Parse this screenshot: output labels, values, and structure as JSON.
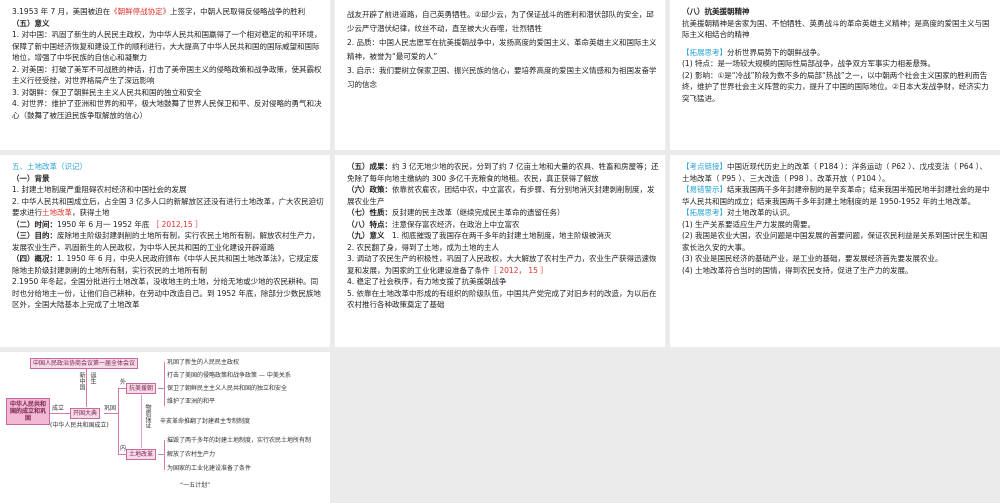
{
  "slides": {
    "r1s1": {
      "line_treaty_prefix": "3.1953 年 7 月，美国被迫在",
      "treaty": "《朝鲜停战协定》",
      "line_treaty_suffix": "上签字，中朝人民取得反侵略战争的胜利",
      "heading": "（五）意义",
      "items": [
        "1. 对中国：巩固了新生的人民民主政权，为中华人民共和国赢得了一个相对稳定的和平环境，保障了新中国经济恢复和建设工作的顺利进行，大大提高了中华人民共和国的国际威望和国际地位，增强了中华民族的自信心和凝聚力",
        "2. 对美国：打破了美军不可战胜的神话，打击了美帝国主义的侵略政策和战争政策，使其霸权主义行径受挫，对世界格局产生了深远影响",
        "3. 对朝鲜：保卫了朝鲜民主主义人民共和国的独立和安全",
        "4. 对世界：维护了亚洲和世界的和平，极大地鼓舞了世界人民保卫和平、反对侵略的勇气和决心（鼓舞了被压迫民族争取解放的信心）"
      ]
    },
    "r1s2": {
      "items": [
        "战友开辟了前进道路，自己英勇牺牲。②邱少云，为了保证战斗的胜利和潜伏部队的安全，邱少云严守潜伏纪律，纹丝不动，直至被大火吞噬，壮烈牺牲",
        "2. 品质：中国人民志愿军在抗美援朝战争中，发扬高度的爱国主义、革命英雄主义和国际主义精神，被誉为“最可爱的人”",
        "3. 启示：我们要树立保家卫国、振兴民族的信心，要培养高度的爱国主义情感和为祖国发奋学习的信念"
      ]
    },
    "r1s3": {
      "heading": "（八）抗美援朝精神",
      "spirit": "抗美援朝精神是舍家为国、不怕牺牲、英勇战斗的革命英雄主义精神；是高度的爱国主义与国际主义相结合的精神",
      "tag": "【拓展思考】",
      "question": "分析世界局势下的朝鲜战争。",
      "items": [
        "(1) 特点：是一场较大规模的国际性局部战争，战争双方军事实力相差悬殊。",
        "(2) 影响：①是“冷战”阶段为数不多的局部“热战”之一，以中朝两个社会主义国家的胜利而告终，维护了世界社会主义阵营的实力，提升了中国的国际地位。②日本大发战争财，经济实力突飞猛进。"
      ]
    },
    "r2s1": {
      "title": "五、土地改革（识记）",
      "h1": "（一）背景",
      "bg1": "1. 封建土地制度严重阻碍农村经济和中国社会的发展",
      "bg2_prefix": "2. 中华人民共和国成立后，占全国 3 亿多人口的新解放区还没有进行土地改革，广大农民迫切要求进行",
      "bg2_red": "土地改革",
      "bg2_suffix": "，获得土地",
      "time_label": "（二）时间：",
      "time": "1950 年 6 月一 1952 年底",
      "time_ref": "［ 2012,15 ］",
      "goal_label": "（三）目的：",
      "goal": "废除地主阶级封建剥削的土地所有制，实行农民土地所有制，解放农村生产力，发展农业生产，巩固新生的人民政权，为中华人民共和国的工业化建设开辟道路",
      "overview_label": "（四）概况：",
      "overview1": "1. 1950 年 6 月，中央人民政府颁布《中华人民共和国土地改革法》，它规定废除地主阶级封建剥削的土地所有制，实行农民的土地所有制",
      "overview2": "2.1950 年冬起，全国分批进行土地改革，没收地主的土地，分给无地或少地的农民耕种。同时也分给地主一份，让他们自己耕种，在劳动中改造自己。到 1952 年底，除部分少数民族地区外，全国大陆基本上完成了土地改革"
    },
    "r2s2": {
      "result_label": "（五）成果：",
      "result": "约 3 亿无地少地的农民，分到了约 7 亿亩土地和大量的农具、牲畜和房屋等；还免除了每年向地主缴纳的 300 多亿千克粮食的地租。农民，真正获得了解放",
      "policy_label": "（六）政策：",
      "policy": "依靠贫农雇农，团结中农，中立富农，有步骤、有分别地消灭封建剥削制度，发展农业生产",
      "nature_label": "（七）性质：",
      "nature": "反封建的民主改革（继续完成民主革命的遗留任务）",
      "feature_label": "（八）特点：",
      "feature": "注意保存富农经济，在政治上中立富农",
      "meaning_label": "（九）意义",
      "m1": "　1. 彻底摧毁了我国存在两千多年的封建土地制度，地主阶级被消灭",
      "m2": "2. 农民翻了身，得到了土地，成为土地的主人",
      "m3": "3. 调动了农民生产的积极性，巩固了人民政权，大大解放了农村生产力，农业生产获得迅速恢复和发展，为国家的工业化建设准备了条件",
      "m3_ref": "［ 2012， 15 ］",
      "m4": "4. 稳定了社会秩序，有力地支援了抗美援朝战争",
      "m5": "5. 依靠在土地改革中形成的有组织的阶级队伍，中国共产党完成了对旧乡村的改造，为以后在农村推行各种政策奠定了基础"
    },
    "r2s3": {
      "tag1": "【考点链接】",
      "link": "中国近现代历史上的改革（ P184 ）：洋务运动（ P62 ）、戊戌变法（ P64 ）、土地改革（ P95 ）、三大改造（ P98 ）、改革开放（ P104 ）。",
      "tag2": "【易错警示】",
      "warn": "结束我国两千多年封建帝制的是辛亥革命；结束我国半殖民地半封建社会的是中华人民共和国的成立；结束我国两千多年封建土地制度的是 1950-1952 年的土地改革。",
      "tag3": "【拓展思考】",
      "q": "对土地改革的认识。",
      "items": [
        "(1) 生产关系要适应生产力发展的需要。",
        "(2) 我国是农业大国，农业问题是中国发展的首要问题，保证农民利益是关系到国计民生和国家长治久安的大事。",
        "(3) 农业是国民经济的基础产业，是工业的基础，要发展经济首先要发展农业。",
        "(4) 土地改革符合当时的国情，得到农民支持，促进了生产力的发展。"
      ]
    },
    "diagram": {
      "top": "中国人民政治协商会议第一届全体会议",
      "root": "中华人民共和国的成立和巩固",
      "v1": "新中国",
      "v2": "诞生",
      "established": "成立",
      "ceremony": "开国大典",
      "ceremony_note": "(中华人民共和国成立)",
      "consolidate": "巩固",
      "outer": "外",
      "inner": "内",
      "kmyc": "抗美援朝",
      "tdgg": "土地改革",
      "material": "物质保证",
      "kmyc_items": [
        "巩固了新生的人民民主政权",
        "打击了美国的侵略政策和战争政策",
        "保卫了朝鲜民主主义人民共和国的独立和安全",
        "维护了亚洲的和平"
      ],
      "sino_us": "中美关系",
      "xinhai": "辛亥革命推翻了封建君主专制制度",
      "tdgg_items": [
        "摧毁了两千多年的封建土地制度，实行农民土地所有制",
        "解放了农村生产力",
        "为国家的工业化建设准备了条件"
      ],
      "plan": "“一五计划”"
    }
  }
}
